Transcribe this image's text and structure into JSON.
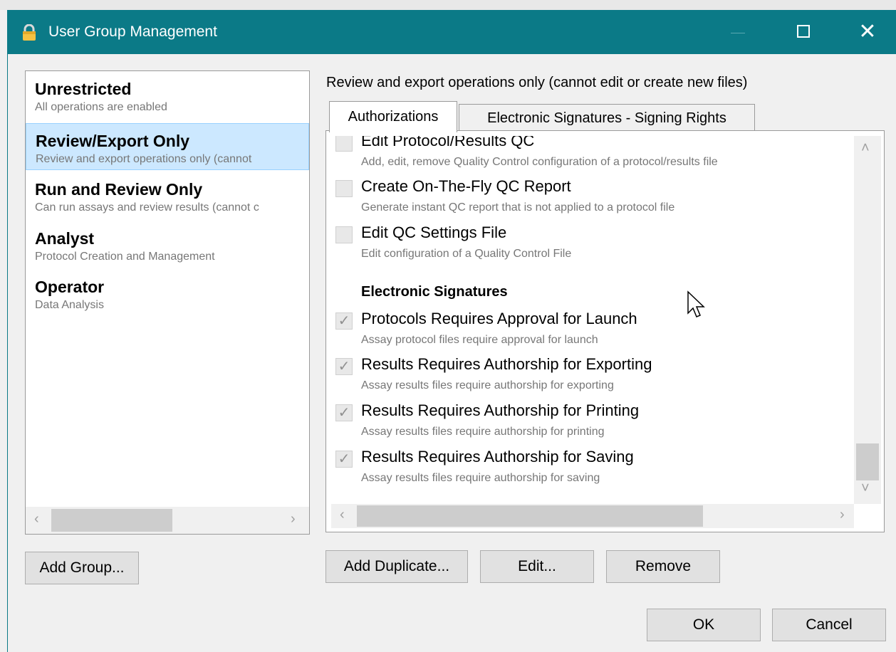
{
  "window": {
    "title": "User Group Management",
    "icon": "lock-icon",
    "titlebar_color": "#0b7a87"
  },
  "groups": [
    {
      "name": "Unrestricted",
      "description": "All operations are enabled",
      "selected": false
    },
    {
      "name": "Review/Export Only",
      "description": "Review and export operations only (cannot",
      "selected": true
    },
    {
      "name": "Run and Review Only",
      "description": "Can run assays and review results (cannot c",
      "selected": false
    },
    {
      "name": "Analyst",
      "description": "Protocol Creation and Management",
      "selected": false
    },
    {
      "name": "Operator",
      "description": "Data Analysis",
      "selected": false
    }
  ],
  "selected_description": "Review and export operations only (cannot edit or create new files)",
  "tabs": [
    {
      "label": "Authorizations",
      "active": true
    },
    {
      "label": "Electronic Signatures - Signing Rights",
      "active": false
    }
  ],
  "authorizations": {
    "items_top": [
      {
        "title": "Edit Protocol/Results QC",
        "subtitle": "Add, edit, remove Quality Control configuration of a protocol/results file",
        "checked": false
      },
      {
        "title": "Create On-The-Fly QC Report",
        "subtitle": "Generate instant QC report that is not applied to a protocol file",
        "checked": false
      },
      {
        "title": "Edit QC Settings File",
        "subtitle": "Edit configuration of a Quality Control File",
        "checked": false
      }
    ],
    "section_heading": "Electronic Signatures",
    "items_bottom": [
      {
        "title": "Protocols Requires Approval for Launch",
        "subtitle": "Assay protocol files require approval for launch",
        "checked": true
      },
      {
        "title": "Results Requires Authorship for Exporting",
        "subtitle": "Assay results files require authorship for exporting",
        "checked": true
      },
      {
        "title": "Results Requires Authorship for Printing",
        "subtitle": "Assay results files require authorship for printing",
        "checked": true
      },
      {
        "title": "Results Requires Authorship for Saving",
        "subtitle": "Assay results files require authorship for saving",
        "checked": true
      }
    ]
  },
  "buttons": {
    "add_group": "Add Group...",
    "add_duplicate": "Add Duplicate...",
    "edit": "Edit...",
    "remove": "Remove",
    "ok": "OK",
    "cancel": "Cancel"
  }
}
